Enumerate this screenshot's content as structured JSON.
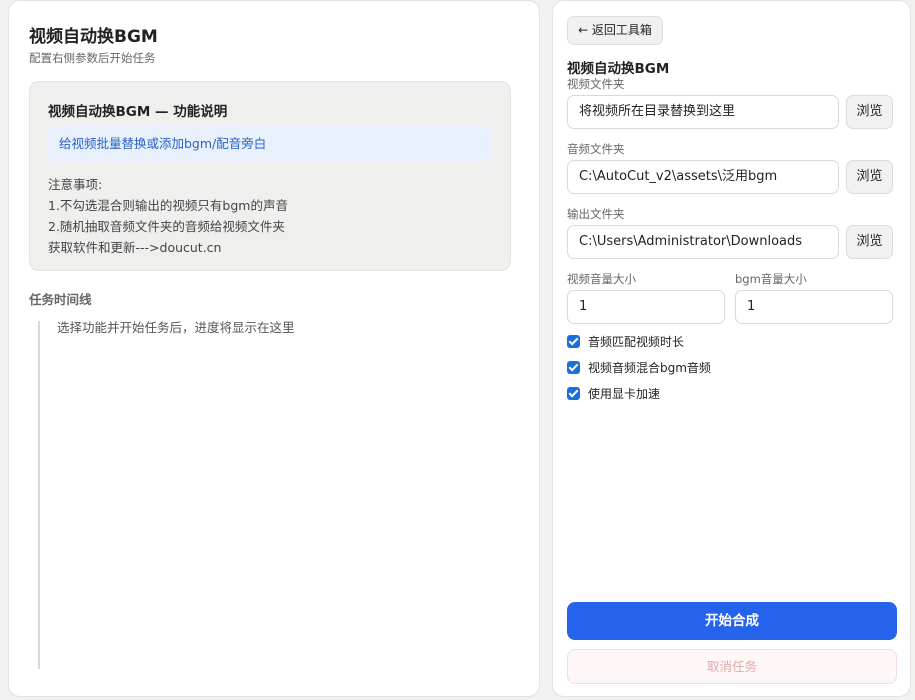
{
  "left": {
    "title": "视频自动换BGM",
    "subtitle": "配置右侧参数后开始任务",
    "description": {
      "title": "视频自动换BGM — 功能说明",
      "highlight": "给视频批量替换或添加bgm/配音旁白",
      "notes": [
        "注意事项:",
        "1.不勾选混合则输出的视频只有bgm的声音",
        "2.随机抽取音频文件夹的音频给视频文件夹",
        "获取软件和更新--->doucut.cn"
      ]
    },
    "timeline": {
      "title": "任务时间线",
      "placeholder": "选择功能并开始任务后，进度将显示在这里"
    }
  },
  "right": {
    "back_label": "← 返回工具箱",
    "title": "视频自动换BGM",
    "video_folder": {
      "label": "视频文件夹",
      "value": "将视频所在目录替换到这里",
      "browse": "浏览"
    },
    "audio_folder": {
      "label": "音频文件夹",
      "value": "C:\\AutoCut_v2\\assets\\泛用bgm",
      "browse": "浏览"
    },
    "output_folder": {
      "label": "输出文件夹",
      "value": "C:\\Users\\Administrator\\Downloads",
      "browse": "浏览"
    },
    "video_volume": {
      "label": "视频音量大小",
      "value": "1"
    },
    "bgm_volume": {
      "label": "bgm音量大小",
      "value": "1"
    },
    "options": [
      {
        "label": "音频匹配视频时长",
        "checked": true
      },
      {
        "label": "视频音频混合bgm音频",
        "checked": true
      },
      {
        "label": "使用显卡加速",
        "checked": true
      }
    ],
    "start_label": "开始合成",
    "cancel_label": "取消任务"
  },
  "colors": {
    "accent": "#2563eb",
    "checkbox": "#1a6fd8",
    "highlight_text": "#2a62c9",
    "cancel_text": "#e3a9a9"
  }
}
